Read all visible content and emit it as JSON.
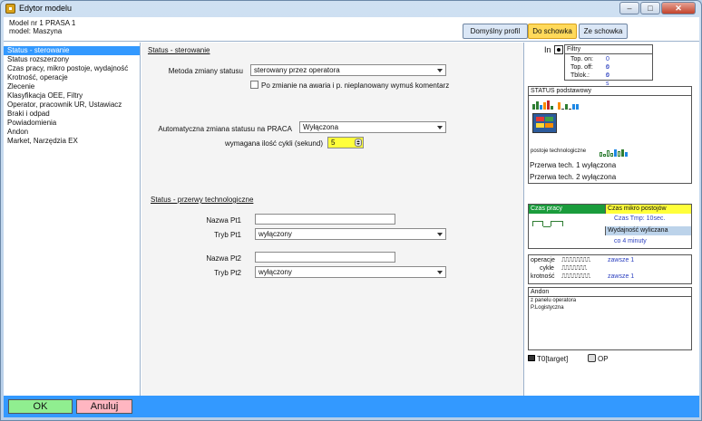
{
  "window": {
    "title": "Edytor modelu",
    "minimize": "–",
    "maximize": "□",
    "close": "✕"
  },
  "header": {
    "model_line": "Model nr 1  PRASA 1",
    "model_name": "model: Maszyna",
    "btn_profile": "Domyślny profil",
    "btn_copy": "Do schowka",
    "btn_paste": "Ze schowka"
  },
  "sidebar": {
    "items": [
      {
        "label": "Status - sterowanie",
        "active": true
      },
      {
        "label": "Status rozszerzony"
      },
      {
        "label": "Czas pracy, mikro postoje, wydajność"
      },
      {
        "label": "Krotność, operacje"
      },
      {
        "label": "Zlecenie"
      },
      {
        "label": "Klasyfikacja OEE, Filtry"
      },
      {
        "label": "Operator, pracownik UR, Ustawiacz"
      },
      {
        "label": "Braki i odpad"
      },
      {
        "label": "Powiadomienia"
      },
      {
        "label": "Andon"
      },
      {
        "label": "Market, Narzędzia EX"
      }
    ]
  },
  "main": {
    "section1_title": "Status - sterowanie",
    "metoda_label": "Metoda zmiany statusu",
    "metoda_value": "sterowany przez operatora",
    "awaria_checkbox_label": "Po zmianie na awaria i p. nieplanowany wymuś komentarz",
    "auto_label": "Automatyczna zmiana statusu na PRACA",
    "auto_value": "Wyłączona",
    "cykle_label": "wymagana ilość cykli (sekund)",
    "cykle_value": "5",
    "section2_title": "Status - przerwy technologiczne",
    "pt1_name_label": "Nazwa Pt1",
    "pt1_name_value": "",
    "pt1_mode_label": "Tryb Pt1",
    "pt1_mode_value": "wyłączony",
    "pt2_name_label": "Nazwa Pt2",
    "pt2_name_value": "",
    "pt2_mode_label": "Tryb Pt2",
    "pt2_mode_value": "wyłączony"
  },
  "right": {
    "in_label": "In",
    "filtry_title": "Filtry",
    "top_on_label": "Top. on:",
    "top_on_value": "0 s",
    "top_off_label": "Top. off:",
    "top_off_value": "0 s",
    "tblok_label": "Tblok.:",
    "tblok_value": "0 s",
    "status_title": "STATUS podstawowy",
    "postoje_label": "postoje technologiczne",
    "przerwa1": "Przerwa tech. 1 wyłączona",
    "przerwa2": "Przerwa tech. 2 wyłączona",
    "czas_pracy": "Czas pracy",
    "czas_mikro": "Czas mikro postojów",
    "czas_tmp": "Czas Tmp: 10sec.",
    "wydajnosc": "Wydajność wyliczana",
    "co_minuty": "co 4 minuty",
    "operacje_label": "operacje",
    "cykle_label": "cykle",
    "krotnosc_label": "krotność",
    "zawsze1": "zawsze 1",
    "zawsze2": "zawsze 1",
    "andon_title": "Andon",
    "andon_line1": "z panelu operatora",
    "andon_line2": "P.Logistyczna",
    "target_label": "T0[target]",
    "op_label": "OP"
  },
  "footer": {
    "ok": "OK",
    "cancel": "Anuluj"
  },
  "colors": {
    "accent": "#3399ff",
    "ok": "#90ee90",
    "cancel": "#ffb6c1",
    "highlight": "#ffff3b"
  }
}
